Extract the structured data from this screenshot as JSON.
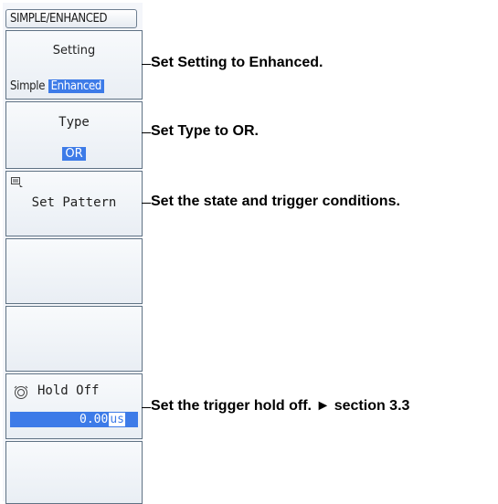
{
  "menu": {
    "header": "SIMPLE/ENHANCED",
    "setting": {
      "title": "Setting",
      "option_simple": "Simple",
      "option_enhanced": "Enhanced",
      "selected": "Enhanced"
    },
    "type": {
      "title": "Type",
      "value": "OR"
    },
    "set_pattern": {
      "title": "Set Pattern",
      "icon": "pattern-icon"
    },
    "hold_off": {
      "title": "Hold Off",
      "value": "0.00",
      "unit": "us",
      "icon": "rotary-knob-icon"
    }
  },
  "callouts": [
    "Set Setting to Enhanced.",
    "Set Type to OR.",
    "Set the state and trigger conditions.",
    "Set the trigger hold off. ► section 3.3"
  ],
  "colors": {
    "accent": "#3d7be8",
    "key_border": "#5f7284",
    "panel_bg": "#f4f6fa"
  }
}
